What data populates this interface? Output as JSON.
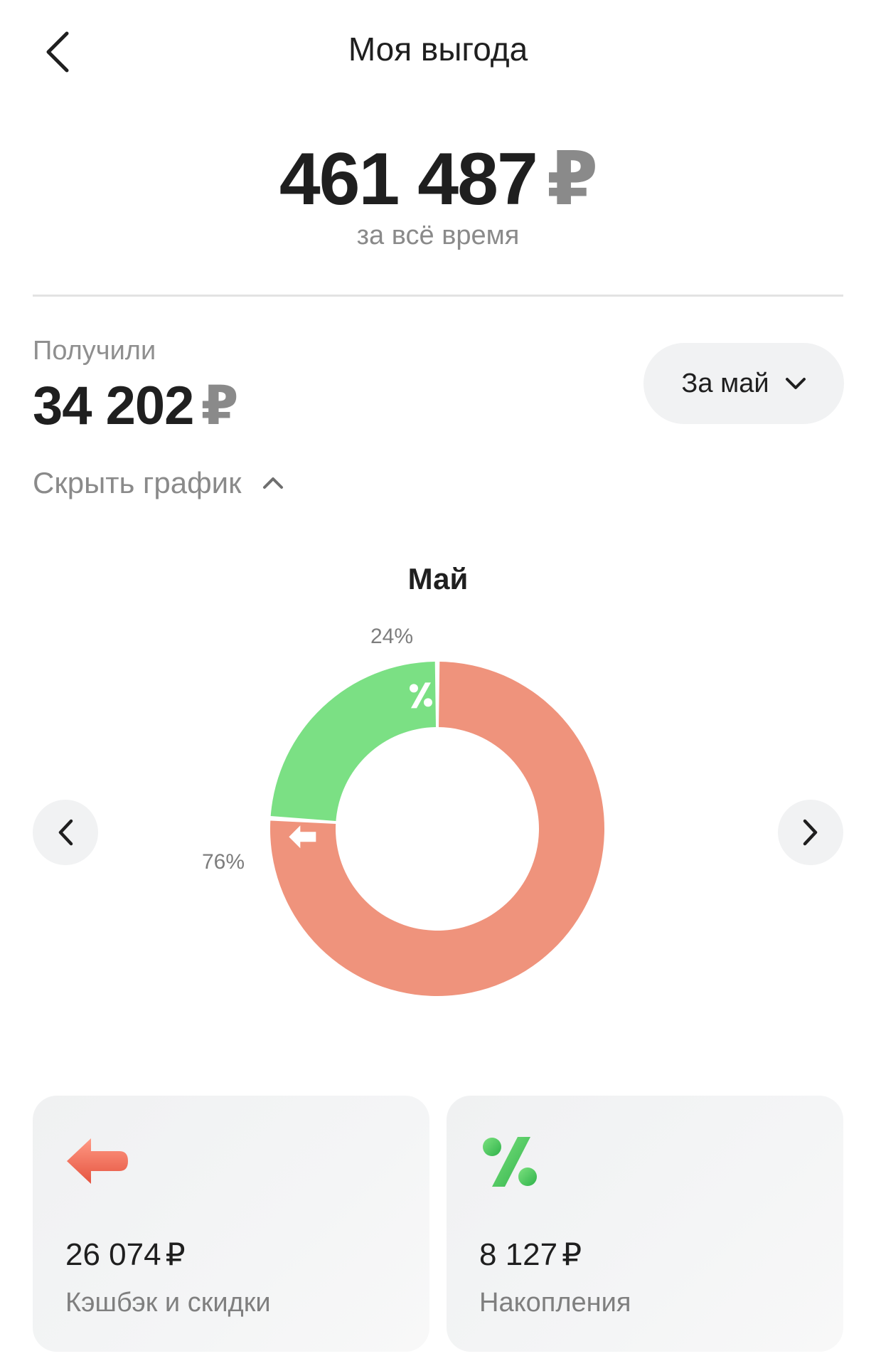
{
  "header": {
    "title": "Моя выгода",
    "back_icon": "chevron-left-icon"
  },
  "total": {
    "amount": "461 487",
    "currency": "₽",
    "subtitle": "за всё время"
  },
  "received": {
    "label": "Получили",
    "amount": "34 202",
    "currency": "₽"
  },
  "period_selector": {
    "label": "За май",
    "icon": "chevron-down-icon"
  },
  "chart_toggle": {
    "label": "Скрыть график",
    "icon": "chevron-up-icon"
  },
  "chart_data": {
    "type": "pie",
    "title": "Май",
    "labels": [
      "Кэшбэк и скидки",
      "Накопления"
    ],
    "values": [
      76,
      24
    ],
    "value_labels": [
      "76%",
      "24%"
    ],
    "colors": [
      "#ef937c",
      "#7be084"
    ],
    "icons": [
      "arrow-left-icon",
      "percent-icon"
    ]
  },
  "chart_nav": {
    "prev_icon": "chevron-left-icon",
    "next_icon": "chevron-right-icon"
  },
  "cards": [
    {
      "amount": "26 074",
      "currency": "₽",
      "label": "Кэшбэк и скидки",
      "icon": "arrow-left-icon",
      "color": "#ef6f5e"
    },
    {
      "amount": "8 127",
      "currency": "₽",
      "label": "Накопления",
      "icon": "percent-icon",
      "color": "#48c95a"
    }
  ]
}
